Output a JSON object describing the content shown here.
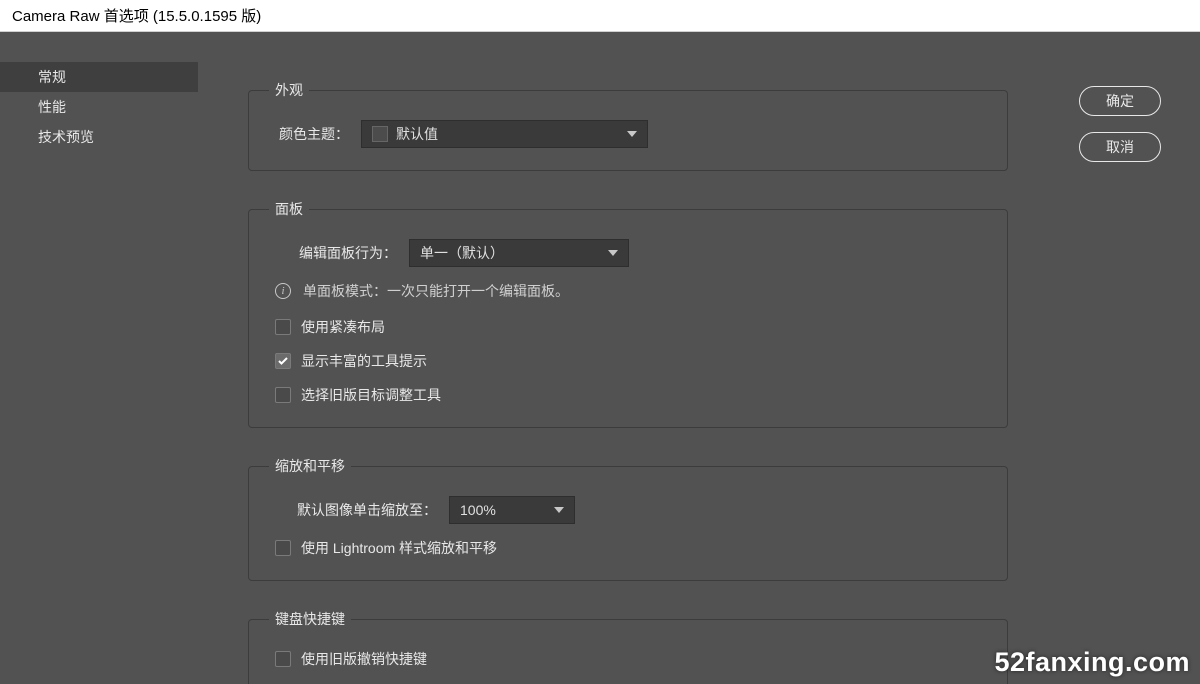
{
  "window": {
    "title": "Camera Raw 首选项  (15.5.0.1595 版)"
  },
  "sidebar": {
    "items": [
      {
        "label": "常规",
        "selected": true
      },
      {
        "label": "性能",
        "selected": false
      },
      {
        "label": "技术预览",
        "selected": false
      }
    ]
  },
  "buttons": {
    "ok": "确定",
    "cancel": "取消"
  },
  "sections": {
    "appearance": {
      "legend": "外观",
      "colorThemeLabel": "颜色主题：",
      "colorThemeValue": "默认值"
    },
    "panel": {
      "legend": "面板",
      "behaviorLabel": "编辑面板行为：",
      "behaviorValue": "单一（默认）",
      "infoText": "单面板模式：一次只能打开一个编辑面板。",
      "compactLayout": {
        "label": "使用紧凑布局",
        "checked": false
      },
      "richTooltips": {
        "label": "显示丰富的工具提示",
        "checked": true
      },
      "legacyTargetAdjust": {
        "label": "选择旧版目标调整工具",
        "checked": false
      }
    },
    "zoom": {
      "legend": "缩放和平移",
      "defaultZoomLabel": "默认图像单击缩放至：",
      "defaultZoomValue": "100%",
      "lightroomStyle": {
        "label": "使用 Lightroom 样式缩放和平移",
        "checked": false
      }
    },
    "shortcuts": {
      "legend": "键盘快捷键",
      "legacyUndo": {
        "label": "使用旧版撤销快捷键",
        "checked": false
      }
    }
  },
  "watermark": "52fanxing.com"
}
